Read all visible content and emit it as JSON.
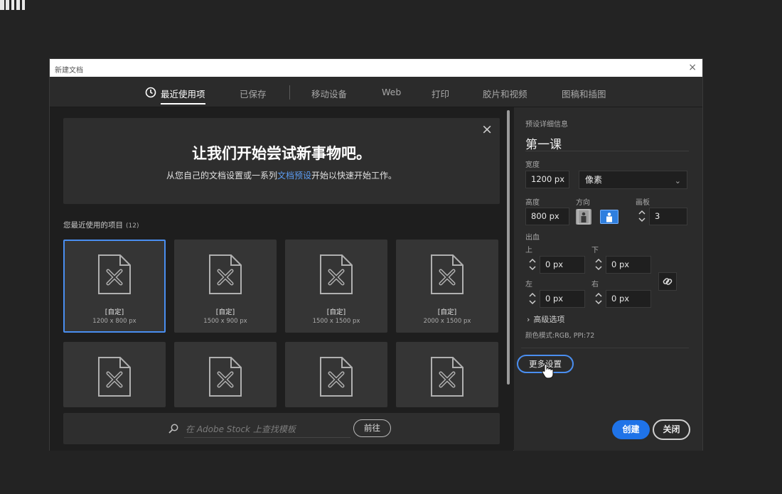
{
  "dialog": {
    "title": "新建文档",
    "close_glyph": "×"
  },
  "tabs": [
    {
      "label": "最近使用项",
      "icon": "clock-icon",
      "active": true
    },
    {
      "label": "已保存"
    },
    {
      "label": "移动设备"
    },
    {
      "label": "Web"
    },
    {
      "label": "打印"
    },
    {
      "label": "胶片和视频"
    },
    {
      "label": "图稿和插图"
    }
  ],
  "banner": {
    "headline": "让我们开始尝试新事物吧。",
    "sub_before": "从您自己的文档设置或一系列",
    "sub_link": "文档预设",
    "sub_after": "开始以快速开始工作。",
    "close_glyph": "×"
  },
  "recent": {
    "label": "您最近使用的项目",
    "count": "(12)",
    "items": [
      {
        "name": "[自定]",
        "size": "1200 x 800 px",
        "selected": true
      },
      {
        "name": "[自定]",
        "size": "1500 x 900 px"
      },
      {
        "name": "[自定]",
        "size": "1500 x 1500 px"
      },
      {
        "name": "[自定]",
        "size": "2000 x 1500 px"
      },
      {
        "name": "",
        "size": ""
      },
      {
        "name": "",
        "size": ""
      },
      {
        "name": "",
        "size": ""
      },
      {
        "name": "",
        "size": ""
      }
    ]
  },
  "stock": {
    "placeholder": "在 Adobe Stock 上查找模板",
    "go_label": "前往"
  },
  "preset": {
    "section_label": "预设详细信息",
    "name": "第一课",
    "width_label": "宽度",
    "width_value": "1200 px",
    "unit": "像素",
    "height_label": "高度",
    "height_value": "800 px",
    "orientation_label": "方向",
    "orientation_selected": "landscape",
    "artboards_label": "画板",
    "artboards_value": "3",
    "bleed_label": "出血",
    "bleed_top_label": "上",
    "bleed_top": "0 px",
    "bleed_bottom_label": "下",
    "bleed_bottom": "0 px",
    "bleed_left_label": "左",
    "bleed_left": "0 px",
    "bleed_right_label": "右",
    "bleed_right": "0 px",
    "advanced_label": "高级选项",
    "color_mode": "颜色模式:RGB, PPI:72",
    "more_settings_label": "更多设置",
    "create_label": "创建",
    "close_label": "关闭"
  },
  "colors": {
    "accent": "#1f73e8",
    "selection": "#4a8ef0",
    "link": "#5c9bf0",
    "dialog_bg": "#1e1e1e",
    "panel_bg": "#2b2b2b"
  }
}
